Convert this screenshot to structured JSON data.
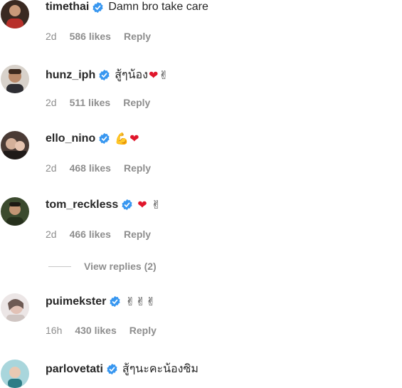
{
  "comments": [
    {
      "username": "timethai",
      "text": "Damn bro take care",
      "emoji": [],
      "time": "2d",
      "likes": "586 likes",
      "reply": "Reply"
    },
    {
      "username": "hunz_iph",
      "text": "สู้ๆน้อง",
      "emoji": [
        "❤",
        "✌"
      ],
      "time": "2d",
      "likes": "511 likes",
      "reply": "Reply"
    },
    {
      "username": "ello_nino",
      "text": "",
      "emoji": [
        "💪",
        "❤"
      ],
      "time": "2d",
      "likes": "468 likes",
      "reply": "Reply"
    },
    {
      "username": "tom_reckless",
      "text": "",
      "emoji": [
        "❤",
        "✌"
      ],
      "time": "2d",
      "likes": "466 likes",
      "reply": "Reply"
    },
    {
      "username": "puimekster",
      "text": "",
      "emoji": [
        "✌",
        "✌",
        "✌"
      ],
      "time": "16h",
      "likes": "430 likes",
      "reply": "Reply"
    },
    {
      "username": "parlovetati",
      "text": "สู้ๆนะคะน้องซิม",
      "emoji": []
    }
  ],
  "view_replies": "View replies (2)",
  "colors": {
    "verified": "#3897f0",
    "heart": "#e0162b",
    "muted": "#8e8e8e"
  }
}
